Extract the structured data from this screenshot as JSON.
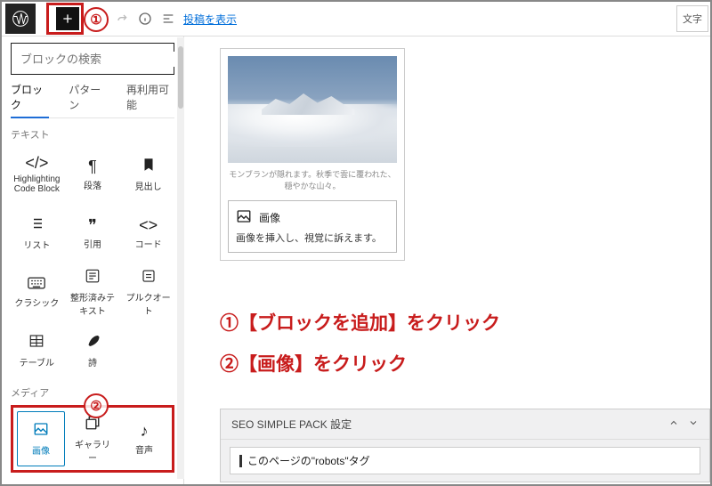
{
  "topbar": {
    "view_link": "投稿を表示",
    "char_button": "文字"
  },
  "search": {
    "placeholder": "ブロックの検索"
  },
  "tabs": {
    "blocks": "ブロック",
    "patterns": "パターン",
    "reusable": "再利用可能"
  },
  "sections": {
    "text": "テキスト",
    "media": "メディア"
  },
  "blocks": {
    "highlighting": "Highlighting Code Block",
    "paragraph": "段落",
    "heading": "見出し",
    "list": "リスト",
    "quote": "引用",
    "code": "コード",
    "classic": "クラシック",
    "preformatted": "整形済みテキスト",
    "pullquote": "プルクオート",
    "table": "テーブル",
    "verse": "詩"
  },
  "media": {
    "image": "画像",
    "gallery": "ギャラリー",
    "audio": "音声"
  },
  "preview": {
    "caption": "モンブランが隠れます。秋季で雲に覆われた、穏やかな山々。",
    "title": "画像",
    "desc": "画像を挿入し、視覚に訴えます。"
  },
  "instructions": {
    "line1": "①【ブロックを追加】をクリック",
    "line2": "②【画像】をクリック"
  },
  "annotations": {
    "one": "①",
    "two": "②"
  },
  "metabox": {
    "title": "SEO SIMPLE PACK 設定",
    "field": "このページの\"robots\"タグ"
  }
}
